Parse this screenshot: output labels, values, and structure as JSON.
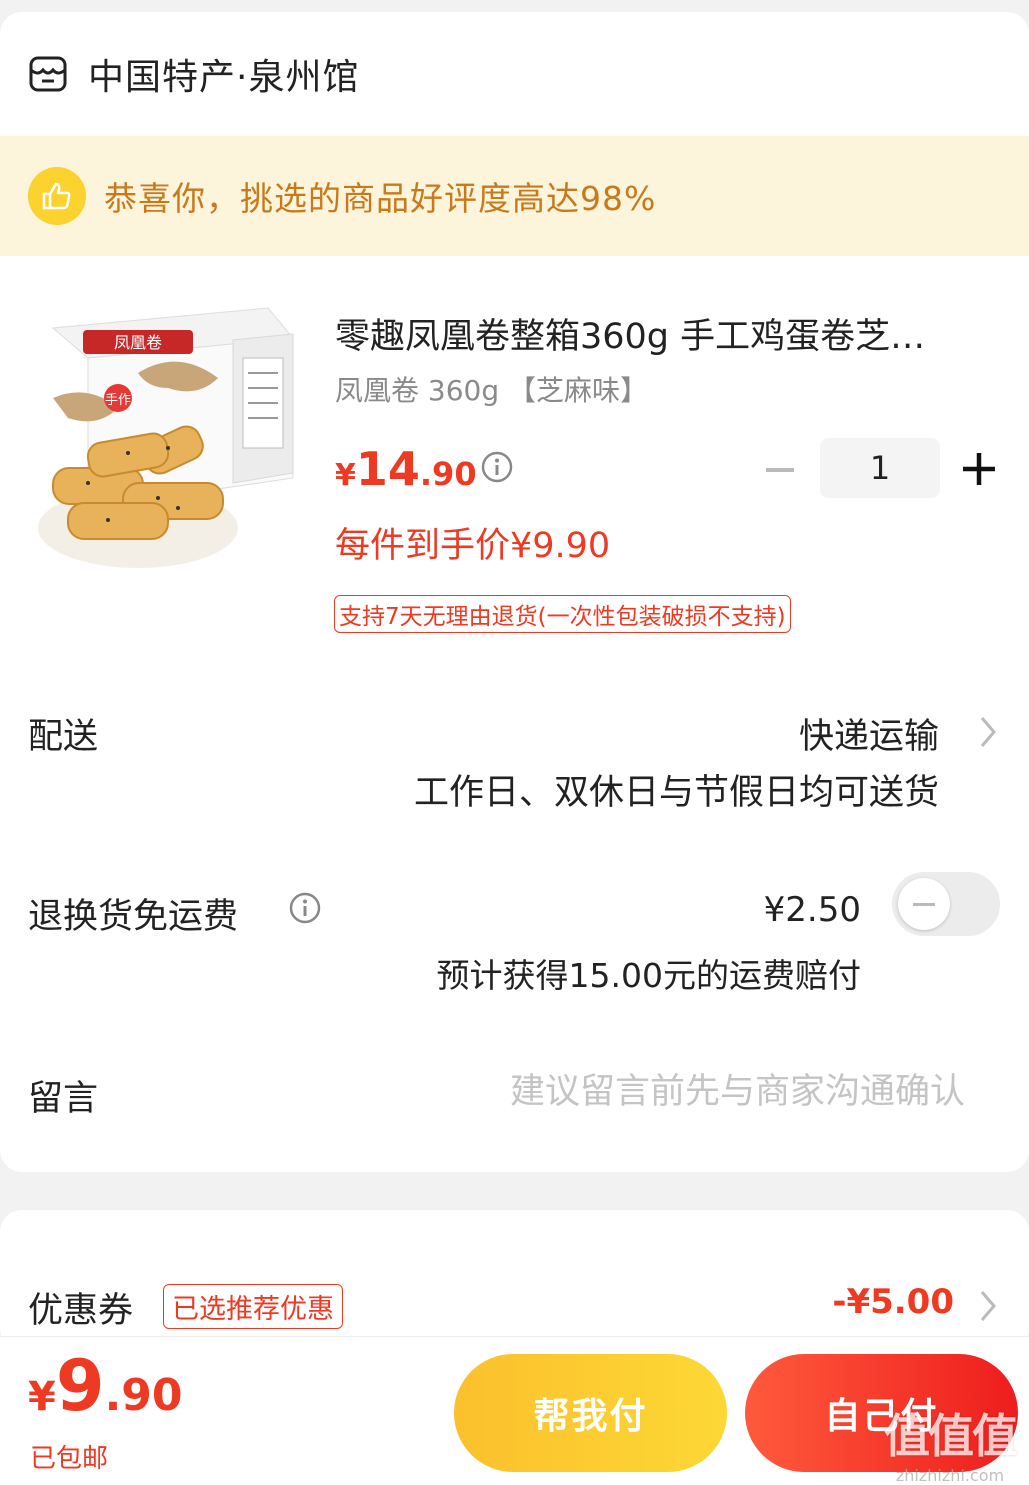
{
  "shop": {
    "name": "中国特产·泉州馆",
    "icon": "store-icon"
  },
  "banner": {
    "text": "恭喜你，挑选的商品好评度高达98%",
    "icon": "thumbs-up-icon"
  },
  "product": {
    "title": "零趣凤凰卷整箱360g 手工鸡蛋卷芝…",
    "spec": "凤凰卷 360g 【芝麻味】",
    "price_currency": "¥",
    "price_int": "14",
    "price_dec": ".90",
    "deal_price": "每件到手价¥9.90",
    "return_policy": "支持7天无理由退货(一次性包装破损不支持)",
    "quantity": "1",
    "image_box_text": "凤凰卷",
    "image_tag_text": "手作"
  },
  "shipping": {
    "label": "配送",
    "method": "快递运输",
    "note": "工作日、双休日与节假日均可送货"
  },
  "return_insurance": {
    "label": "退换货免运费",
    "price": "¥2.50",
    "note": "预计获得15.00元的运费赔付",
    "enabled": false
  },
  "message": {
    "label": "留言",
    "placeholder": "建议留言前先与商家沟通确认"
  },
  "coupon": {
    "label": "优惠券",
    "tag": "已选推荐优惠",
    "amount": "-¥5.00"
  },
  "footer": {
    "total_currency": "¥",
    "total_int": "9",
    "total_dec": ".90",
    "free_shipping": "已包邮",
    "help_pay": "帮我付",
    "self_pay": "自己付"
  },
  "watermark": {
    "mark": "值值值",
    "site": "zhizhizhi.com"
  },
  "colors": {
    "accent_red": "#ee3a22",
    "banner_bg": "#fdf4dc",
    "banner_text": "#c8791a",
    "help_btn": "#fbc02d",
    "self_btn": "#ee1d1d"
  }
}
